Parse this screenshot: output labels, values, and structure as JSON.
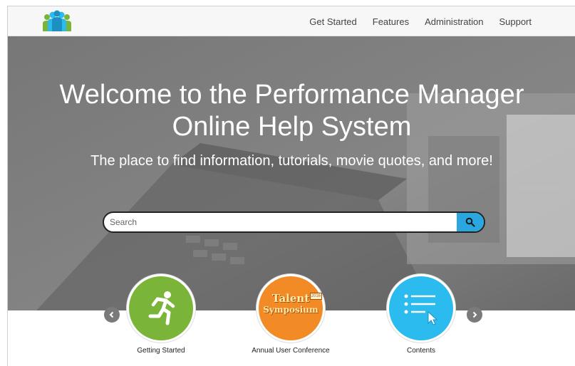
{
  "header": {
    "logo_icon": "people-group-icon",
    "nav": [
      {
        "label": "Get Started"
      },
      {
        "label": "Features"
      },
      {
        "label": "Administration"
      },
      {
        "label": "Support"
      }
    ]
  },
  "hero": {
    "title_line1": "Welcome to the Performance Manager",
    "title_line2": "Online Help System",
    "subtitle": "The place to find information, tutorials, movie quotes, and more!"
  },
  "search": {
    "placeholder": "Search",
    "button_icon": "search-icon",
    "button_color": "#2aa7df"
  },
  "carousel": {
    "prev_icon": "chevron-left-icon",
    "next_icon": "chevron-right-icon",
    "tiles": [
      {
        "label": "Getting Started",
        "icon": "running-person-icon",
        "color": "#7ab53a"
      },
      {
        "label": "Annual User Conference",
        "icon": "talent-symposium-logo",
        "color": "#f28a25",
        "logo_text_1": "Talent",
        "logo_text_2": "Symposium",
        "logo_badge": "2016"
      },
      {
        "label": "Contents",
        "icon": "list-cursor-icon",
        "color": "#2bbbee"
      }
    ]
  }
}
